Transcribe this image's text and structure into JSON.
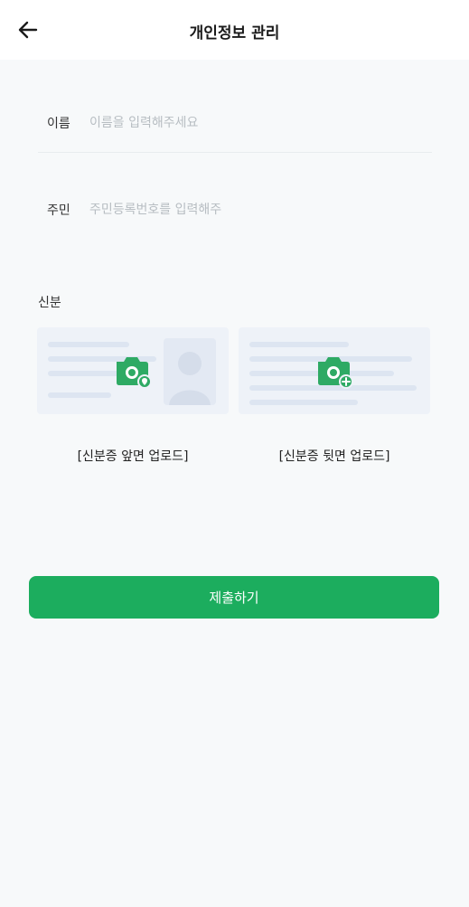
{
  "header": {
    "back_icon": "arrow-left-icon",
    "title": "개인정보 관리"
  },
  "form": {
    "name": {
      "label": "이름",
      "placeholder": "이름을 입력해주세요",
      "value": ""
    },
    "id_number": {
      "label": "주민",
      "placeholder": "주민등록번호를 입력해주",
      "value": ""
    }
  },
  "id_section": {
    "label": "신분",
    "front": {
      "caption": "[신분증 앞면 업로드]",
      "icon": "camera-icon"
    },
    "back": {
      "caption": "[신분증 뒷면 업로드]",
      "icon": "camera-plus-icon"
    }
  },
  "submit": {
    "label": "제출하기"
  },
  "colors": {
    "accent": "#1cad5e",
    "icon_green": "#2eaa64"
  }
}
